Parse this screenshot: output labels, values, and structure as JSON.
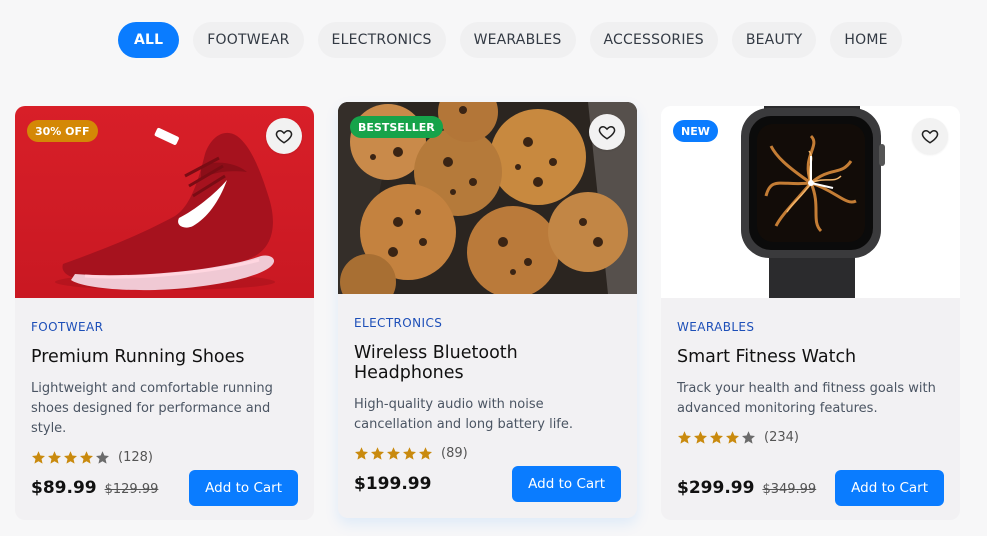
{
  "filters": {
    "all": "ALL",
    "footwear": "FOOTWEAR",
    "electronics": "ELECTRONICS",
    "wearables": "WEARABLES",
    "accessories": "ACCESSORIES",
    "beauty": "BEAUTY",
    "home": "HOME"
  },
  "colors": {
    "accent": "#0a7cff",
    "category_text": "#1d4fb8",
    "badge_discount": "#d48806",
    "badge_bestseller": "#16a34a",
    "badge_new": "#0a7cff",
    "star": "#c98a0e"
  },
  "products": [
    {
      "badge": "30% OFF",
      "image_icon": "red-running-shoe-image",
      "category": "FOOTWEAR",
      "title": "Premium Running Shoes",
      "description": "Lightweight and comfortable running shoes designed for performance and style.",
      "rating": 4,
      "reviews": "(128)",
      "price": "$89.99",
      "old_price": "$129.99",
      "button": "Add to Cart"
    },
    {
      "badge": "BESTSELLER",
      "image_icon": "cookies-image",
      "category": "ELECTRONICS",
      "title": "Wireless Bluetooth Headphones",
      "description": "High-quality audio with noise cancellation and long battery life.",
      "rating": 5,
      "reviews": "(89)",
      "price": "$199.99",
      "button": "Add to Cart"
    },
    {
      "badge": "NEW",
      "image_icon": "smartwatch-image",
      "category": "WEARABLES",
      "title": "Smart Fitness Watch",
      "description": "Track your health and fitness goals with advanced monitoring features.",
      "rating": 4,
      "reviews": "(234)",
      "price": "$299.99",
      "old_price": "$349.99",
      "button": "Add to Cart"
    }
  ]
}
